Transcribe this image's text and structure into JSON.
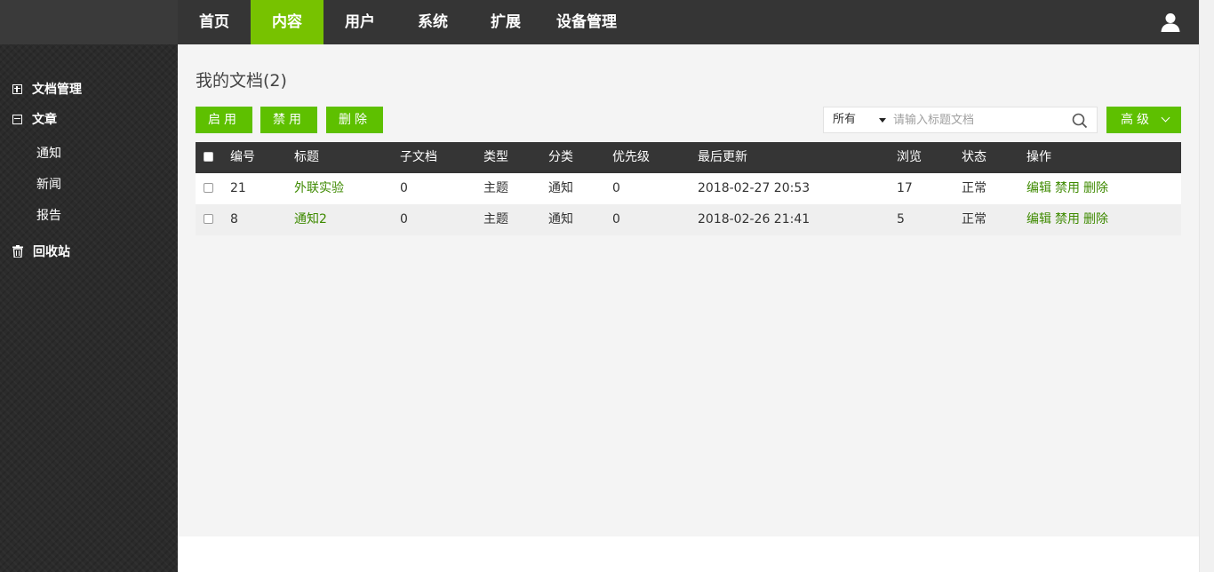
{
  "nav": {
    "items": [
      {
        "label": "首页",
        "active": false
      },
      {
        "label": "内容",
        "active": true
      },
      {
        "label": "用户",
        "active": false
      },
      {
        "label": "系统",
        "active": false
      },
      {
        "label": "扩展",
        "active": false
      },
      {
        "label": "设备管理",
        "active": false
      }
    ],
    "active_color": "#77c200",
    "user_icon": "user-icon"
  },
  "sidebar": {
    "doc_manage": "文档管理",
    "article": "文章",
    "subitems": [
      "通知",
      "新闻",
      "报告"
    ],
    "recycle": "回收站"
  },
  "main": {
    "title": "我的文档(2)",
    "buttons": {
      "enable": "启用",
      "disable": "禁用",
      "delete": "删除"
    },
    "search": {
      "select_value": "所有",
      "placeholder": "请输入标题文档"
    },
    "advanced": "高级",
    "accent_color": "#5ec000"
  },
  "table": {
    "headers": [
      "编号",
      "标题",
      "子文档",
      "类型",
      "分类",
      "优先级",
      "最后更新",
      "浏览",
      "状态",
      "操作"
    ],
    "rows": [
      {
        "id": "21",
        "title": "外联实验",
        "children": "0",
        "type": "主题",
        "category": "通知",
        "priority": "0",
        "updated": "2018-02-27 20:53",
        "views": "17",
        "status": "正常",
        "ops": [
          "编辑",
          "禁用",
          "删除"
        ]
      },
      {
        "id": "8",
        "title": "通知2",
        "children": "0",
        "type": "主题",
        "category": "通知",
        "priority": "0",
        "updated": "2018-02-26 21:41",
        "views": "5",
        "status": "正常",
        "ops": [
          "编辑",
          "禁用",
          "删除"
        ]
      }
    ]
  }
}
